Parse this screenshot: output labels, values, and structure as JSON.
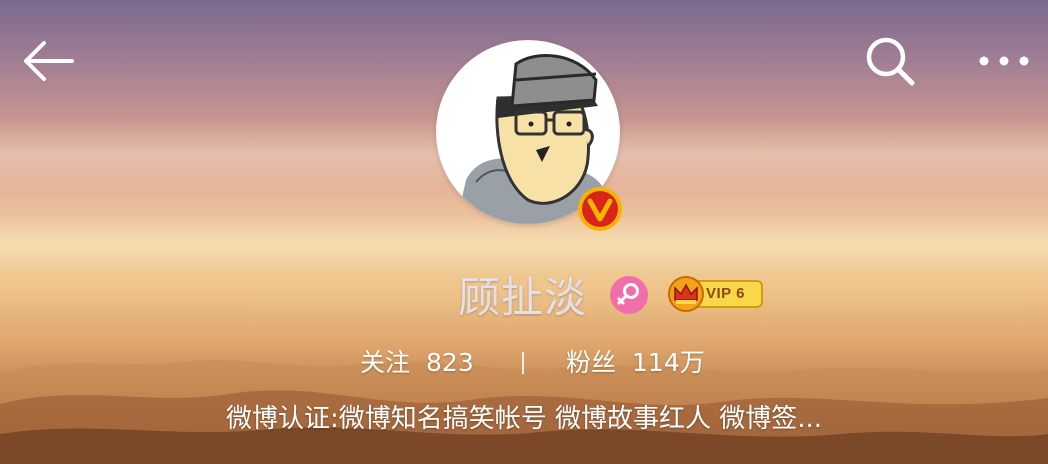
{
  "profile": {
    "name": "顾扯淡",
    "vip_label": "VIP 6",
    "stats": {
      "follow_label": "关注",
      "follow_count": "823",
      "fans_label": "粉丝",
      "fans_count": "114万"
    },
    "bio": "微博认证:微博知名搞笑帐号 微博故事红人 微博签..."
  },
  "icons": {
    "back": "back-arrow-icon",
    "search": "search-icon",
    "more": "more-dots-icon",
    "verified": "verified-v-icon",
    "gender": "female-gender-icon",
    "vip": "vip-crown-icon"
  },
  "colors": {
    "verified_bg": "#d9231c",
    "verified_ring": "#f4b400",
    "gender_bg": "#f06ea9",
    "vip_bg": "#f8d84a"
  }
}
